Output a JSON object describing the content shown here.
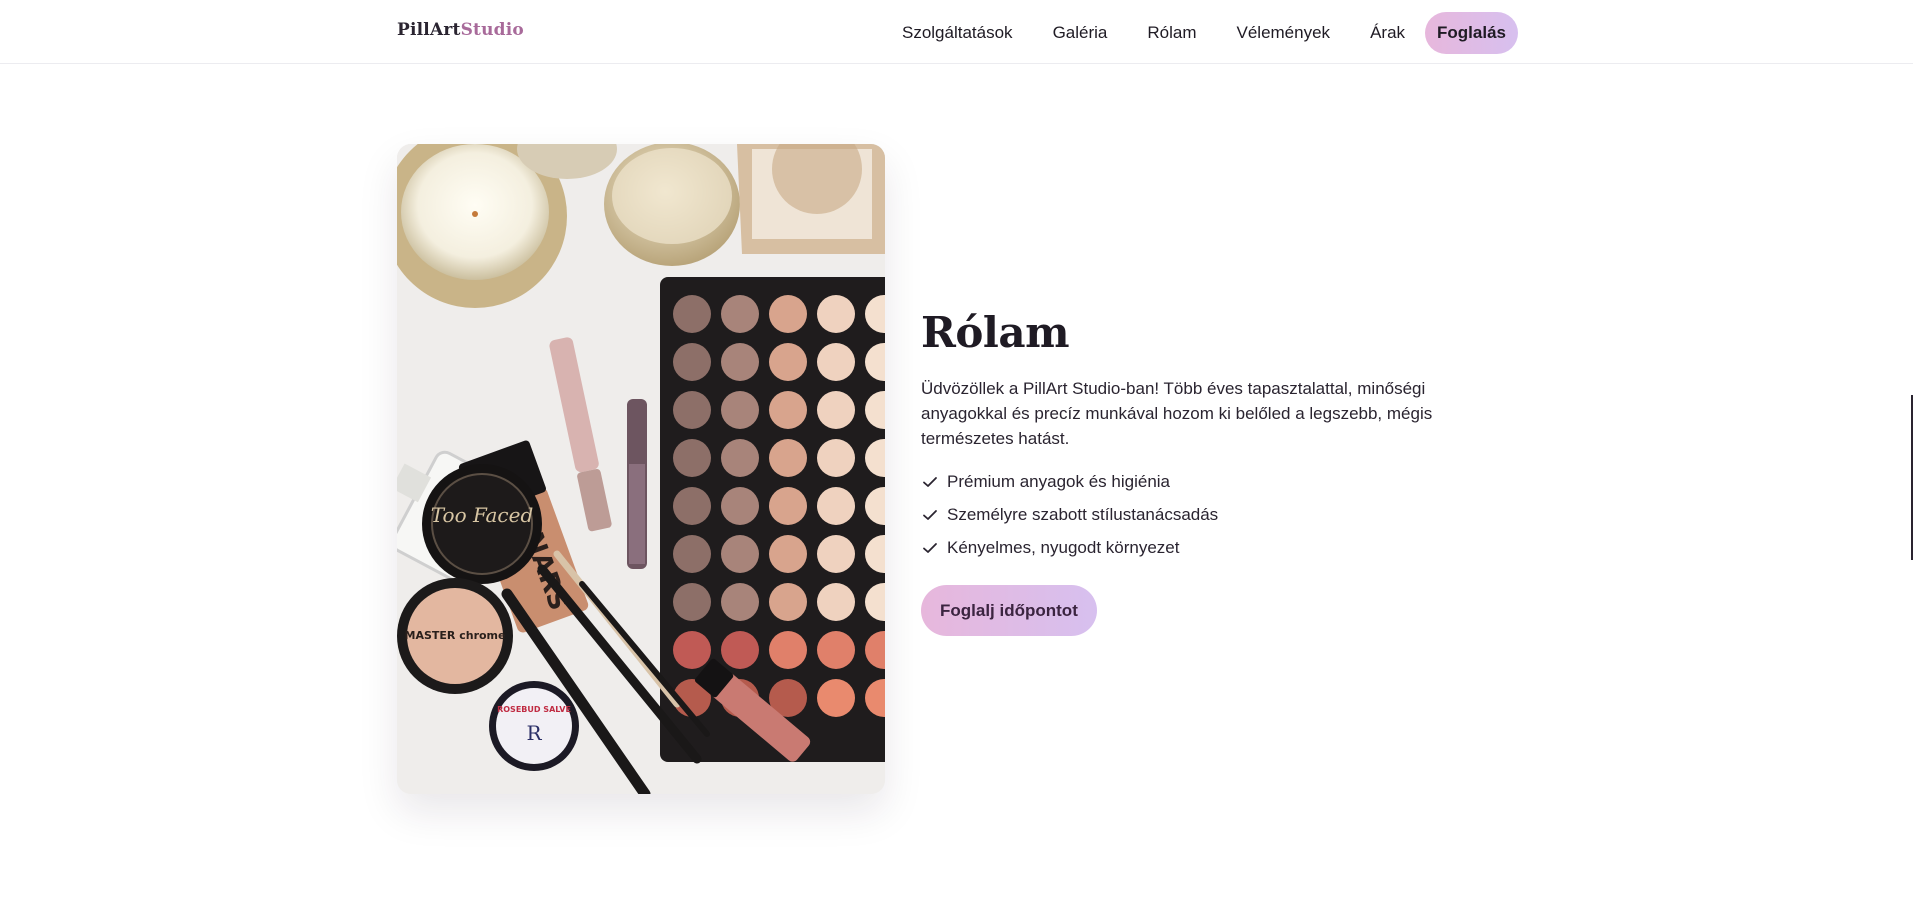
{
  "header": {
    "logo_main": "PillArt",
    "logo_accent": "Studio",
    "nav": [
      {
        "label": "Szolgáltatások"
      },
      {
        "label": "Galéria"
      },
      {
        "label": "Rólam"
      },
      {
        "label": "Vélemények"
      },
      {
        "label": "Árak"
      }
    ],
    "cta_label": "Foglalás"
  },
  "about": {
    "title": "Rólam",
    "intro": "Üdvözöllek a PillArt Studio-ban! Több éves tapasztalattal, minőségi anyagokkal és precíz munkával hozom ki belőled a legszebb, mégis természetes hatást.",
    "features": [
      {
        "text": "Prémium anyagok és higiénia",
        "icon": "check-icon"
      },
      {
        "text": "Személyre szabott stílustanácsadás",
        "icon": "check-icon"
      },
      {
        "text": "Kényelmes, nyugodt környezet",
        "icon": "check-icon"
      }
    ],
    "button_label": "Foglalj időpontot",
    "image_subject": "makeup-flatlay-image"
  },
  "photo_labels": {
    "powder": "Too Faced",
    "highlighter": "MASTER chrome",
    "foundation": "NARS",
    "salve": "ROSEBUD SALVE",
    "salve_mark": "R"
  },
  "colors": {
    "accent": "#a86a9a",
    "button_gradient_start": "#e7b7dc",
    "button_gradient_end": "#d7c0ef",
    "text": "#1f1b24"
  }
}
